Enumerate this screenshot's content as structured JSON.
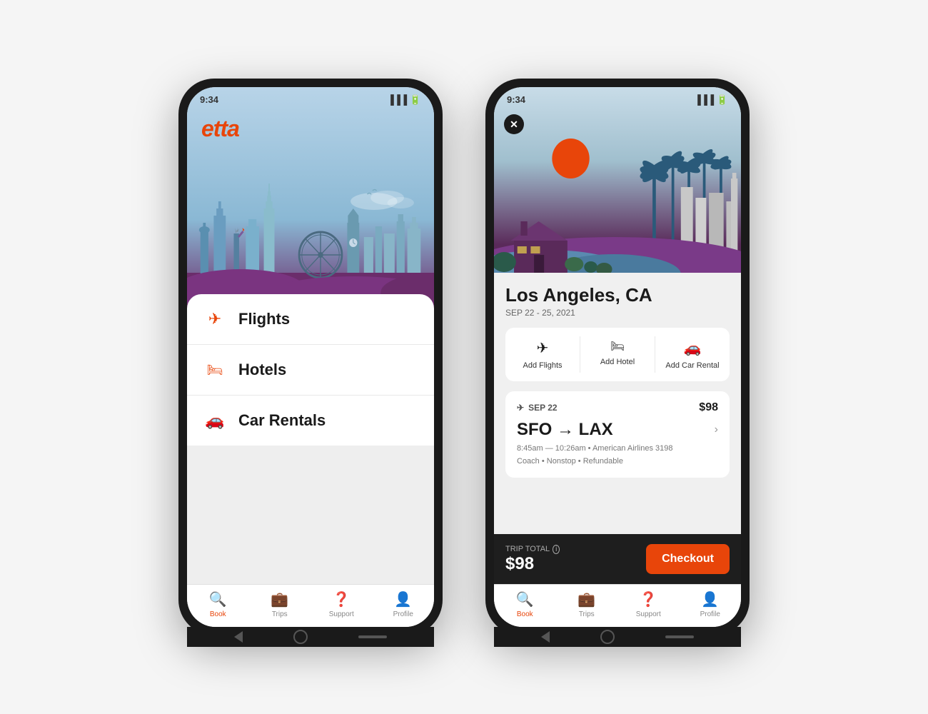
{
  "phone1": {
    "status": {
      "time": "9:34",
      "signal": "▐▐▐",
      "battery": "🔋"
    },
    "logo": "etta",
    "menu": {
      "items": [
        {
          "id": "flights",
          "icon": "✈",
          "label": "Flights"
        },
        {
          "id": "hotels",
          "icon": "🛏",
          "label": "Hotels"
        },
        {
          "id": "car-rentals",
          "icon": "🚗",
          "label": "Car Rentals"
        }
      ]
    },
    "bottomNav": {
      "items": [
        {
          "id": "book",
          "icon": "🔍",
          "label": "Book",
          "active": true
        },
        {
          "id": "trips",
          "icon": "💼",
          "label": "Trips",
          "active": false
        },
        {
          "id": "support",
          "icon": "❓",
          "label": "Support",
          "active": false
        },
        {
          "id": "profile",
          "icon": "👤",
          "label": "Profile",
          "active": false
        }
      ]
    }
  },
  "phone2": {
    "status": {
      "time": "9:34"
    },
    "closeBtn": "✕",
    "city": "Los Angeles, CA",
    "dates": "SEP 22 - 25, 2021",
    "addServices": [
      {
        "id": "add-flights",
        "icon": "✈",
        "label": "Add Flights"
      },
      {
        "id": "add-hotel",
        "icon": "🛏",
        "label": "Add Hotel"
      },
      {
        "id": "add-car",
        "icon": "🚗",
        "label": "Add Car Rental"
      }
    ],
    "flightCard": {
      "date": "SEP 22",
      "price": "$98",
      "route": "SFO → LAX",
      "details1": "8:45am — 10:26am • American Airlines 3198",
      "details2": "Coach • Nonstop • Refundable"
    },
    "checkout": {
      "totalLabel": "TRIP TOTAL",
      "totalPrice": "$98",
      "btnLabel": "Checkout"
    },
    "bottomNav": {
      "items": [
        {
          "id": "book",
          "icon": "🔍",
          "label": "Book",
          "active": true
        },
        {
          "id": "trips",
          "icon": "💼",
          "label": "Trips",
          "active": false
        },
        {
          "id": "support",
          "icon": "❓",
          "label": "Support",
          "active": false
        },
        {
          "id": "profile",
          "icon": "👤",
          "label": "Profile",
          "active": false
        }
      ]
    }
  },
  "colors": {
    "brand": "#e8450a",
    "dark": "#1a1a1a",
    "skyBlue": "#8ab8d4",
    "purple": "#6b2d6b"
  }
}
